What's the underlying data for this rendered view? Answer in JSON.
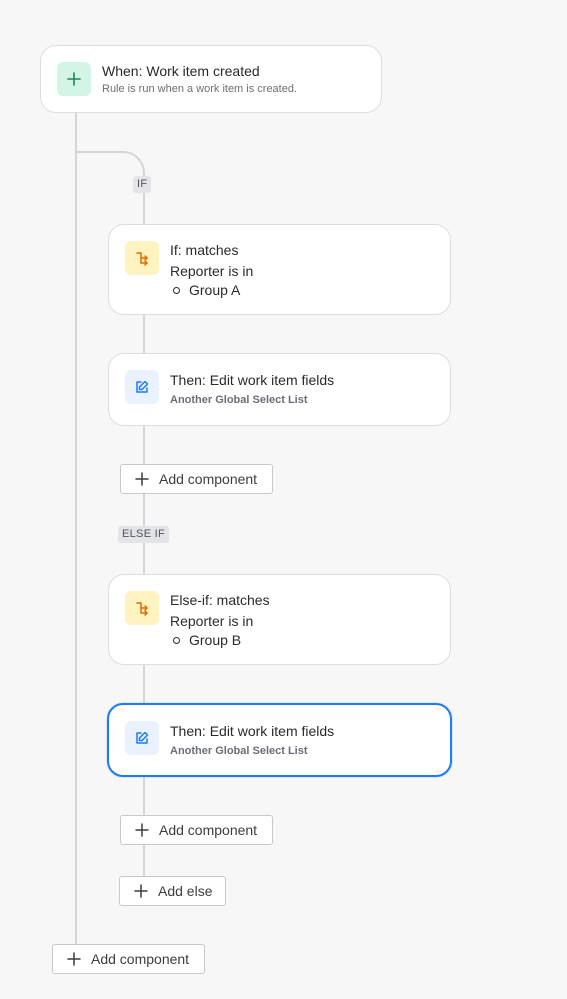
{
  "trigger": {
    "title": "When: Work item created",
    "subtitle": "Rule is run when a work item is created.",
    "icon": "plus-icon",
    "icon_color": "#1f845a"
  },
  "if_branch": {
    "label": "IF",
    "condition": {
      "title": "If: matches",
      "line": "Reporter is in",
      "item": "Group A",
      "icon": "branch-icon"
    },
    "action": {
      "title": "Then: Edit work item fields",
      "subtitle": "Another Global Select List",
      "icon": "edit-icon"
    },
    "add_component_label": "Add component"
  },
  "else_if_branch": {
    "label": "ELSE IF",
    "condition": {
      "title": "Else-if: matches",
      "line": "Reporter is in",
      "item": "Group B",
      "icon": "branch-icon"
    },
    "action": {
      "title": "Then: Edit work item fields",
      "subtitle": "Another Global Select List",
      "icon": "edit-icon",
      "selected": true
    },
    "add_component_label": "Add component"
  },
  "add_else_label": "Add else",
  "root_add_component_label": "Add component",
  "colors": {
    "selected_border": "#1d7afc",
    "branch_icon": "#e06c00",
    "edit_icon": "#1d7afc"
  }
}
